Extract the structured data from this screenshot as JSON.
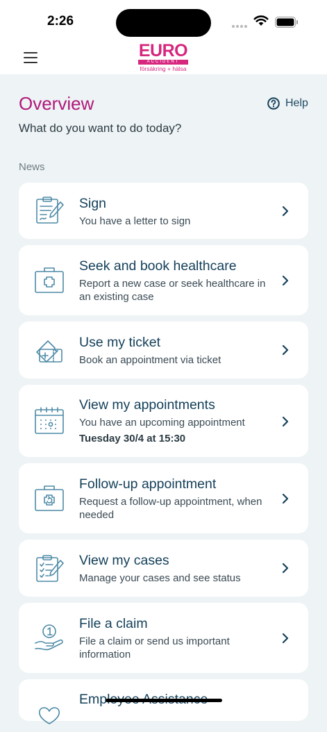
{
  "status_bar": {
    "time": "2:26"
  },
  "logo": {
    "word": "EURO",
    "band": "ACCIDENT",
    "tagline": "försäkring + hälsa"
  },
  "page": {
    "title": "Overview",
    "subtitle": "What do you want to do today?",
    "section_label": "News"
  },
  "help": {
    "label": "Help",
    "icon": "question-circle-icon"
  },
  "cards": [
    {
      "icon": "sign-document-icon",
      "title": "Sign",
      "desc": "You have a letter to sign"
    },
    {
      "icon": "first-aid-kit-icon",
      "title": "Seek and book healthcare",
      "desc": "Report a new case or seek healthcare in an existing case"
    },
    {
      "icon": "ticket-icon",
      "title": "Use my ticket",
      "desc": "Book an appointment via ticket"
    },
    {
      "icon": "calendar-icon",
      "title": "View my appointments",
      "desc": "You have an upcoming appointment",
      "extra": "Tuesday 30/4 at 15:30"
    },
    {
      "icon": "followup-kit-icon",
      "title": "Follow-up appointment",
      "desc": "Request a follow-up appointment, when needed"
    },
    {
      "icon": "clipboard-check-icon",
      "title": "View my cases",
      "desc": "Manage your cases and see status"
    },
    {
      "icon": "coin-hand-icon",
      "title": "File a claim",
      "desc": "File a claim or send us important information"
    },
    {
      "icon": "heart-hands-icon",
      "title": "Employee Assistance"
    }
  ],
  "colors": {
    "brand_pink": "#d6267e",
    "title_magenta": "#b0187a",
    "navy": "#14405a",
    "icon_blue": "#4d8aa6",
    "background": "#eef3f5"
  }
}
